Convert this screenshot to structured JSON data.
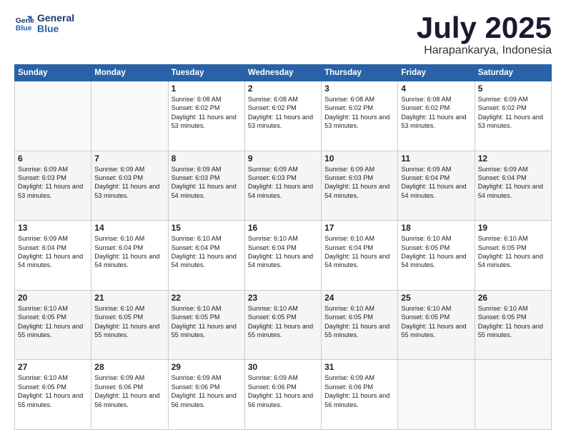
{
  "header": {
    "logo_line1": "General",
    "logo_line2": "Blue",
    "month": "July 2025",
    "location": "Harapankarya, Indonesia"
  },
  "days_of_week": [
    "Sunday",
    "Monday",
    "Tuesday",
    "Wednesday",
    "Thursday",
    "Friday",
    "Saturday"
  ],
  "weeks": [
    [
      {
        "day": "",
        "text": ""
      },
      {
        "day": "",
        "text": ""
      },
      {
        "day": "1",
        "text": "Sunrise: 6:08 AM\nSunset: 6:02 PM\nDaylight: 11 hours and 53 minutes."
      },
      {
        "day": "2",
        "text": "Sunrise: 6:08 AM\nSunset: 6:02 PM\nDaylight: 11 hours and 53 minutes."
      },
      {
        "day": "3",
        "text": "Sunrise: 6:08 AM\nSunset: 6:02 PM\nDaylight: 11 hours and 53 minutes."
      },
      {
        "day": "4",
        "text": "Sunrise: 6:08 AM\nSunset: 6:02 PM\nDaylight: 11 hours and 53 minutes."
      },
      {
        "day": "5",
        "text": "Sunrise: 6:09 AM\nSunset: 6:02 PM\nDaylight: 11 hours and 53 minutes."
      }
    ],
    [
      {
        "day": "6",
        "text": "Sunrise: 6:09 AM\nSunset: 6:03 PM\nDaylight: 11 hours and 53 minutes."
      },
      {
        "day": "7",
        "text": "Sunrise: 6:09 AM\nSunset: 6:03 PM\nDaylight: 11 hours and 53 minutes."
      },
      {
        "day": "8",
        "text": "Sunrise: 6:09 AM\nSunset: 6:03 PM\nDaylight: 11 hours and 54 minutes."
      },
      {
        "day": "9",
        "text": "Sunrise: 6:09 AM\nSunset: 6:03 PM\nDaylight: 11 hours and 54 minutes."
      },
      {
        "day": "10",
        "text": "Sunrise: 6:09 AM\nSunset: 6:03 PM\nDaylight: 11 hours and 54 minutes."
      },
      {
        "day": "11",
        "text": "Sunrise: 6:09 AM\nSunset: 6:04 PM\nDaylight: 11 hours and 54 minutes."
      },
      {
        "day": "12",
        "text": "Sunrise: 6:09 AM\nSunset: 6:04 PM\nDaylight: 11 hours and 54 minutes."
      }
    ],
    [
      {
        "day": "13",
        "text": "Sunrise: 6:09 AM\nSunset: 6:04 PM\nDaylight: 11 hours and 54 minutes."
      },
      {
        "day": "14",
        "text": "Sunrise: 6:10 AM\nSunset: 6:04 PM\nDaylight: 11 hours and 54 minutes."
      },
      {
        "day": "15",
        "text": "Sunrise: 6:10 AM\nSunset: 6:04 PM\nDaylight: 11 hours and 54 minutes."
      },
      {
        "day": "16",
        "text": "Sunrise: 6:10 AM\nSunset: 6:04 PM\nDaylight: 11 hours and 54 minutes."
      },
      {
        "day": "17",
        "text": "Sunrise: 6:10 AM\nSunset: 6:04 PM\nDaylight: 11 hours and 54 minutes."
      },
      {
        "day": "18",
        "text": "Sunrise: 6:10 AM\nSunset: 6:05 PM\nDaylight: 11 hours and 54 minutes."
      },
      {
        "day": "19",
        "text": "Sunrise: 6:10 AM\nSunset: 6:05 PM\nDaylight: 11 hours and 54 minutes."
      }
    ],
    [
      {
        "day": "20",
        "text": "Sunrise: 6:10 AM\nSunset: 6:05 PM\nDaylight: 11 hours and 55 minutes."
      },
      {
        "day": "21",
        "text": "Sunrise: 6:10 AM\nSunset: 6:05 PM\nDaylight: 11 hours and 55 minutes."
      },
      {
        "day": "22",
        "text": "Sunrise: 6:10 AM\nSunset: 6:05 PM\nDaylight: 11 hours and 55 minutes."
      },
      {
        "day": "23",
        "text": "Sunrise: 6:10 AM\nSunset: 6:05 PM\nDaylight: 11 hours and 55 minutes."
      },
      {
        "day": "24",
        "text": "Sunrise: 6:10 AM\nSunset: 6:05 PM\nDaylight: 11 hours and 55 minutes."
      },
      {
        "day": "25",
        "text": "Sunrise: 6:10 AM\nSunset: 6:05 PM\nDaylight: 11 hours and 55 minutes."
      },
      {
        "day": "26",
        "text": "Sunrise: 6:10 AM\nSunset: 6:05 PM\nDaylight: 11 hours and 55 minutes."
      }
    ],
    [
      {
        "day": "27",
        "text": "Sunrise: 6:10 AM\nSunset: 6:05 PM\nDaylight: 11 hours and 55 minutes."
      },
      {
        "day": "28",
        "text": "Sunrise: 6:09 AM\nSunset: 6:06 PM\nDaylight: 11 hours and 56 minutes."
      },
      {
        "day": "29",
        "text": "Sunrise: 6:09 AM\nSunset: 6:06 PM\nDaylight: 11 hours and 56 minutes."
      },
      {
        "day": "30",
        "text": "Sunrise: 6:09 AM\nSunset: 6:06 PM\nDaylight: 11 hours and 56 minutes."
      },
      {
        "day": "31",
        "text": "Sunrise: 6:09 AM\nSunset: 6:06 PM\nDaylight: 11 hours and 56 minutes."
      },
      {
        "day": "",
        "text": ""
      },
      {
        "day": "",
        "text": ""
      }
    ]
  ]
}
